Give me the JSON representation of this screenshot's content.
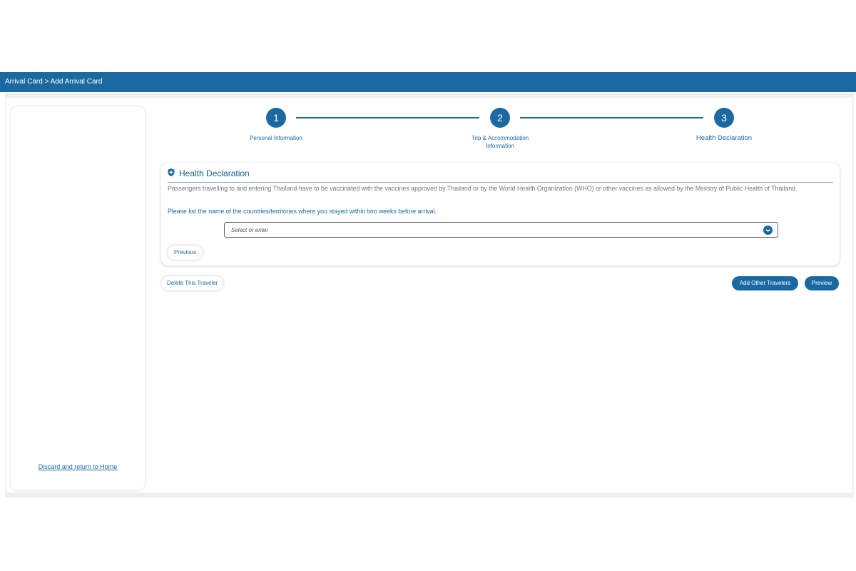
{
  "header": {
    "breadcrumb": "Arrival Card > Add Arrival Card"
  },
  "sidebar": {
    "discard_link": "Discard and return to Home"
  },
  "stepper": {
    "steps": [
      {
        "number": "1",
        "label": "Personal Information"
      },
      {
        "number": "2",
        "label": "Trip & Accommodation Information"
      },
      {
        "number": "3",
        "label": "Health Declaration"
      }
    ]
  },
  "health_card": {
    "icon": "shield-icon",
    "title": "Health Declaration",
    "description": "Passengers travelling to and entering Thailand have to be vaccinated with the vaccines approved by Thailand or by the World Health Organization (WHO) or other vaccines as allowed by the Ministry of Public Health of Thailand.",
    "question": "Please list the name of the countries/territories where you stayed within two weeks before arrival.",
    "select_placeholder": "Select or enter",
    "previous_label": "Previous"
  },
  "actions": {
    "delete_label": "Delete This Traveler",
    "add_label": "Add Other Travelers",
    "preview_label": "Preview"
  },
  "colors": {
    "primary": "#1a6aa1",
    "frame_bg": "#efefef"
  }
}
